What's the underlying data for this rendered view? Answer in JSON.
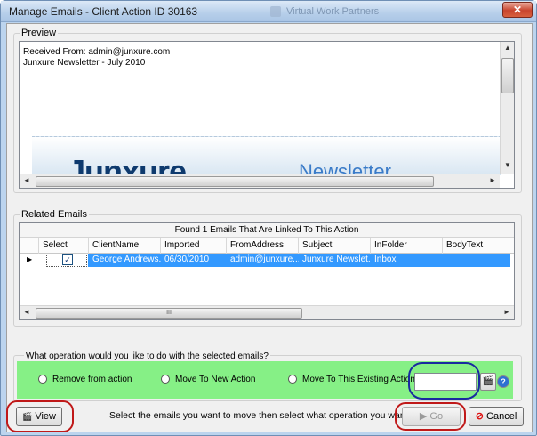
{
  "window": {
    "title": "Manage Emails - Client Action ID 30163",
    "background_title": "Virtual Work Partners",
    "close_glyph": "✕"
  },
  "preview": {
    "legend": "Preview",
    "received_from": "Received From: admin@junxure.com",
    "subject": "Junxure Newsletter - July 2010",
    "banner_logo": "Junxure",
    "banner_text": "Newsletter"
  },
  "related_emails": {
    "legend": "Related Emails",
    "caption": "Found 1 Emails That Are Linked To This Action",
    "columns": [
      "Select",
      "ClientName",
      "Imported",
      "FromAddress",
      "Subject",
      "InFolder",
      "BodyText"
    ],
    "rows": [
      {
        "selected": true,
        "check_glyph": "✓",
        "client_name": "George  Andrews...",
        "imported": "06/30/2010",
        "from_address": "admin@junxure....",
        "subject": "Junxure Newslet...",
        "in_folder": "Inbox",
        "body_text": ""
      }
    ],
    "hscroll_grip": "III"
  },
  "operation": {
    "question": "What operation would you like to do with the selected emails?",
    "options": [
      "Remove from action",
      "Move To New Action",
      "Move To This Existing Action"
    ],
    "existing_action_value": ""
  },
  "footer": {
    "view_label": "View",
    "instruction": "Select the emails you want to move then select what operation you want to do...",
    "go_label": "Go",
    "cancel_label": "Cancel"
  },
  "colors": {
    "selection": "#3399ff",
    "operation_panel": "#86f086",
    "highlight_ring_red": "#c01919",
    "highlight_ring_blue": "#1a2aa0"
  }
}
